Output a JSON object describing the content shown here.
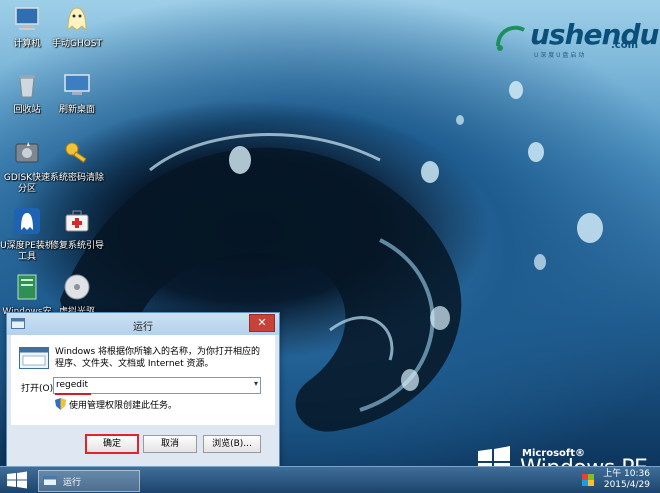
{
  "desktop": {
    "icons": [
      {
        "label": "计算机"
      },
      {
        "label": "手动GHOST"
      },
      {
        "label": "回收站"
      },
      {
        "label": "刷新桌面"
      },
      {
        "label": "GDISK快速分区"
      },
      {
        "label": "系统密码清除"
      },
      {
        "label": "U深度PE装机工具"
      },
      {
        "label": "修复系统引导"
      },
      {
        "label": "Windows安"
      },
      {
        "label": "虚拟光驱"
      }
    ],
    "logo": {
      "text": "ushendu",
      "domain": ".com",
      "tagline": "U 深 度 U 盘 启 动"
    },
    "os_brand": {
      "microsoft": "Microsoft®",
      "name": "Windows PE"
    }
  },
  "run_dialog": {
    "title": "运行",
    "close": "✕",
    "message": "Windows 将根据你所输入的名称，为你打开相应的程序、文件夹、文档或 Internet 资源。",
    "open_label": "打开(O):",
    "open_value": "regedit",
    "admin_note": "使用管理权限创建此任务。",
    "ok": "确定",
    "cancel": "取消",
    "browse": "浏览(B)..."
  },
  "taskbar": {
    "task_label": "运行",
    "clock_period": "上午 10:36",
    "clock_date": "2015/4/29"
  }
}
